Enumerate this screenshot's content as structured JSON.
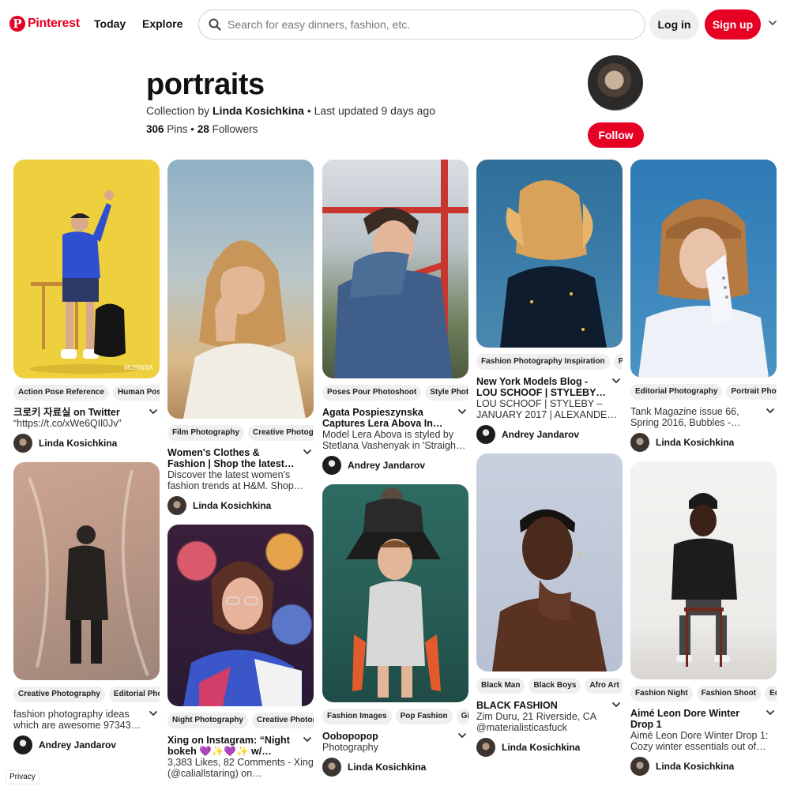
{
  "header": {
    "brand": "Pinterest",
    "logo_letter": "P",
    "nav": [
      "Today",
      "Explore"
    ],
    "search_placeholder": "Search for easy dinners, fashion, etc.",
    "login_label": "Log in",
    "signup_label": "Sign up",
    "accent": "#e60023"
  },
  "board": {
    "title": "portraits",
    "collection_prefix": "Collection by",
    "owner": "Linda Kosichkina",
    "updated": "• Last updated 9 days ago",
    "pins_count": "306",
    "pins_label": "Pins •",
    "followers_count": "28",
    "followers_label": "Followers",
    "follow_label": "Follow"
  },
  "pins": [
    {
      "tags": [
        "Action Pose Reference",
        "Human Pose"
      ],
      "title": "크로키 자료실 on Twitter",
      "desc": "“https://t.co/xWe6QIl0Jv”",
      "user": "Linda Kosichkina",
      "watermark": "MUSINSA"
    },
    {
      "tags": [
        "Creative Photography",
        "Editorial Photo"
      ],
      "title": "",
      "desc": "fashion photography ideas which are awesome 97343…",
      "user": "Andrey Jandarov"
    },
    {
      "tags": [
        "Film Photography",
        "Creative Photogra"
      ],
      "title": "Women's Clothes & Fashion | Shop the latest…",
      "desc": "Discover the latest women's fashion trends at H&M. Shop…",
      "user": "Linda Kosichkina"
    },
    {
      "tags": [
        "Night Photography",
        "Creative Photog"
      ],
      "title": "Xing on Instagram: “Night bokeh 💜✨💜✨ w/…",
      "desc": "3,383 Likes, 82 Comments - Xing (@caliallstaring) on…",
      "user": ""
    },
    {
      "tags": [
        "Poses Pour Photoshoot",
        "Style Photo"
      ],
      "title": "Agata Pospieszynska Captures Lera Abova In…",
      "desc": "Model Lera Abova is styled by Stetlana Vashenyak in 'Straigh…",
      "user": "Andrey Jandarov"
    },
    {
      "tags": [
        "Fashion Images",
        "Pop Fashion",
        "Girl"
      ],
      "title": "Oobopopop",
      "desc": "Photography",
      "user": "Linda Kosichkina"
    },
    {
      "tags": [
        "Fashion Photography Inspiration",
        "Po"
      ],
      "title": "New York Models Blog - LOU SCHOOF | STYLEBY…",
      "desc": "LOU SCHOOF | STYLEBY – JANUARY 2017 | ALEXANDE…",
      "user": "Andrey Jandarov"
    },
    {
      "tags": [
        "Black Man",
        "Black Boys",
        "Afro Art"
      ],
      "title": "BLACK FASHION",
      "desc": "Zim Duru, 21 Riverside, CA @materialisticasfuck",
      "user": "Linda Kosichkina"
    },
    {
      "tags": [
        "Editorial Photography",
        "Portrait Photo"
      ],
      "title": "",
      "desc": "Tank Magazine issue 66, Spring 2016, Bubbles -…",
      "user": "Linda Kosichkina"
    },
    {
      "tags": [
        "Fashion Night",
        "Fashion Shoot",
        "Edi"
      ],
      "title": "Aimé Leon Dore Winter Drop 1",
      "desc": "Aimé Leon Dore Winter Drop 1: Cozy winter essentials out of…",
      "user": "Linda Kosichkina"
    }
  ],
  "footer": {
    "privacy": "Privacy"
  }
}
